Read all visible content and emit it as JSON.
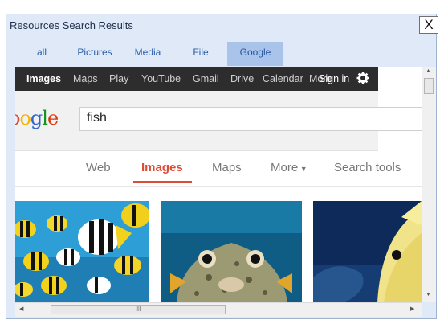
{
  "window": {
    "title": "Resources Search Results",
    "close_label": "X"
  },
  "tabs": [
    {
      "label": "all"
    },
    {
      "label": "Pictures"
    },
    {
      "label": "Media"
    },
    {
      "label": "File"
    },
    {
      "label": "Google",
      "active": true
    }
  ],
  "google_bar": {
    "items": [
      "Images",
      "Maps",
      "Play",
      "YouTube",
      "Gmail",
      "Drive",
      "Calendar",
      "More",
      "Sign in"
    ],
    "gear_icon": "gear-icon"
  },
  "search": {
    "logo_text": "oogle",
    "query": "fish"
  },
  "nav": {
    "web": "Web",
    "images": "Images",
    "maps": "Maps",
    "more": "More",
    "search_tools": "Search tools",
    "active": "Images"
  },
  "results": [
    {
      "alt": "tropical fish school",
      "icon": "fish-school-image"
    },
    {
      "alt": "puffer fish",
      "icon": "puffer-fish-image"
    },
    {
      "alt": "yellow fish in blue water",
      "icon": "yellow-fish-image"
    }
  ],
  "scrollbar": {
    "h_thumb_grip": "III"
  },
  "colors": {
    "accent_red": "#dd4b39",
    "gbar": "#2d2d2d",
    "tab_active": "#a9c3ea",
    "link_blue": "#2a5fa8"
  }
}
